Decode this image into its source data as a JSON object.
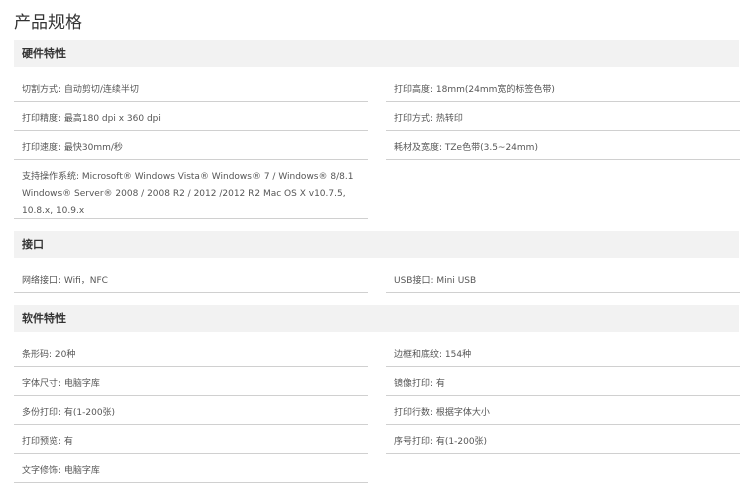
{
  "page": {
    "title": "产品规格"
  },
  "sections": [
    {
      "header": "硬件特性",
      "rows": [
        {
          "left": "切割方式: 自动剪切/连续半切",
          "right": "打印高度: 18mm(24mm宽的标签色带)"
        },
        {
          "left": "打印精度: 最高180 dpi x 360 dpi",
          "right": "打印方式: 热转印"
        },
        {
          "left": "打印速度: 最快30mm/秒",
          "right": "耗材及宽度: TZe色带(3.5~24mm)"
        },
        {
          "left": "支持操作系统: Microsoft® Windows Vista® Windows® 7 / Windows® 8/8.1 Windows® Server® 2008 / 2008 R2 / 2012 /2012 R2 Mac OS X v10.7.5, 10.8.x, 10.9.x",
          "right": ""
        }
      ]
    },
    {
      "header": "接口",
      "rows": [
        {
          "left": "网络接口: Wifi，NFC",
          "right": "USB接口: Mini USB"
        }
      ]
    },
    {
      "header": "软件特性",
      "rows": [
        {
          "left": "条形码: 20种",
          "right": "边框和底纹: 154种"
        },
        {
          "left": "字体尺寸: 电脑字库",
          "right": "镜像打印: 有"
        },
        {
          "left": "多份打印: 有(1-200张)",
          "right": "打印行数: 根据字体大小"
        },
        {
          "left": "打印预览: 有",
          "right": "序号打印: 有(1-200张)"
        },
        {
          "left": "文字修饰: 电脑字库",
          "right": ""
        }
      ]
    }
  ]
}
